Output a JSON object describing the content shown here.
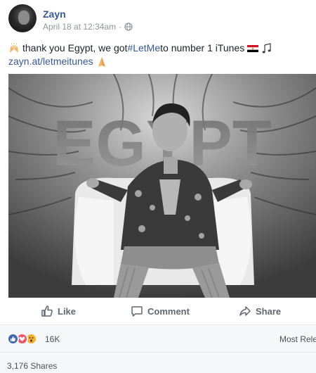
{
  "post": {
    "author": "Zayn",
    "timestamp": "April 18 at 12:34am",
    "separator": "·",
    "privacy_icon": "globe-icon",
    "text_before_hashtag": "thank you Egypt, we got ",
    "hashtag": "#LetMe",
    "text_after_hashtag": " to number 1 iTunes",
    "link": "zayn.at/letmeitunes",
    "emojis": [
      "raised-hands-emoji",
      "egypt-flag-emoji",
      "music-notes-emoji",
      "folded-hands-emoji"
    ]
  },
  "photo": {
    "overlay_text": "EGYPT",
    "description_icon": "photo"
  },
  "actions": {
    "like": "Like",
    "comment": "Comment",
    "share": "Share"
  },
  "reactions": {
    "icons": [
      "like-reaction-icon",
      "love-reaction-icon",
      "wow-reaction-icon"
    ],
    "count": "16K",
    "sort_label": "Most Rele"
  },
  "shares": {
    "label": "3,176 Shares"
  },
  "colors": {
    "link": "#365899",
    "like_blue": "#4267b2",
    "love_red": "#f25268",
    "wow_yellow": "#f7b125",
    "muted": "#90949c"
  }
}
